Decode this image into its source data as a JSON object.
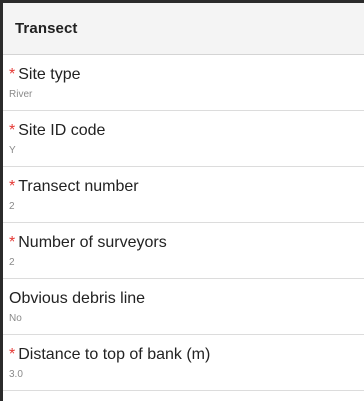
{
  "section": {
    "title": "Transect"
  },
  "required_marker": "*",
  "fields": [
    {
      "label": "Site type",
      "value": "River",
      "required": true
    },
    {
      "label": "Site ID code",
      "value": "Y",
      "required": true
    },
    {
      "label": "Transect number",
      "value": "2",
      "required": true
    },
    {
      "label": "Number of surveyors",
      "value": "2",
      "required": true
    },
    {
      "label": "Obvious debris line",
      "value": "No",
      "required": false
    },
    {
      "label": "Distance to top of bank (m)",
      "value": "3.0",
      "required": true
    }
  ],
  "colors": {
    "required_marker": "#e53935",
    "label_text": "#222222",
    "value_text": "#8a8a8a",
    "header_background": "#f4f4f4"
  }
}
